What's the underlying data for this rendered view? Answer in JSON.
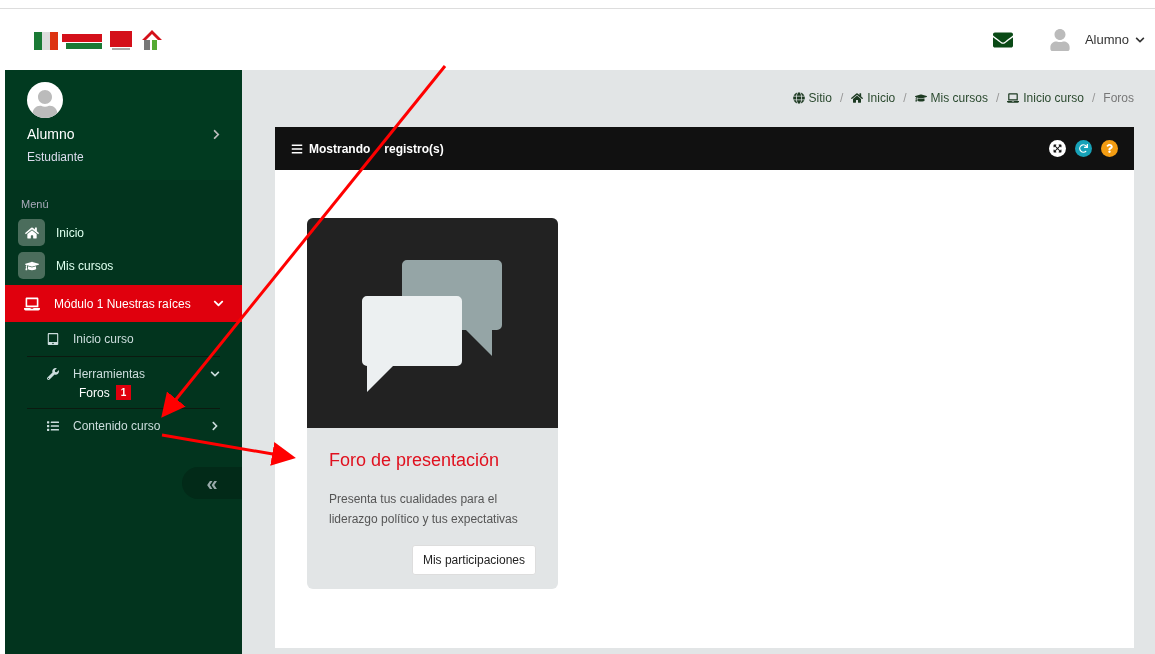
{
  "header": {
    "user": "Alumno"
  },
  "sidebar": {
    "profile": {
      "name": "Alumno",
      "role": "Estudiante"
    },
    "menu_label": "Menú",
    "items": [
      {
        "kind": "top",
        "label": "Inicio",
        "selected": false
      },
      {
        "kind": "top",
        "label": "Mis cursos",
        "selected": false
      },
      {
        "kind": "module",
        "label": "Módulo 1 Nuestras raíces",
        "selected": true,
        "expanded": true,
        "children": [
          {
            "label": "Inicio curso"
          },
          {
            "label": "Herramientas",
            "expanded": true,
            "children": [
              {
                "label": "Foros",
                "badge": "1"
              }
            ]
          },
          {
            "label": "Contenido curso",
            "expanded": false
          }
        ]
      }
    ],
    "collapse": "«"
  },
  "breadcrumb": {
    "separator": "/",
    "items": [
      "Sitio",
      "Inicio",
      "Mis cursos",
      "Inicio curso",
      "Foros"
    ]
  },
  "panel": {
    "title_parts": [
      "Mostrando",
      "registro(s)"
    ]
  },
  "cards": [
    {
      "title": "Foro de presentación",
      "description": "Presenta tus cualidades para el liderazgo político y tus expectativas",
      "button": "Mis participaciones"
    }
  ]
}
